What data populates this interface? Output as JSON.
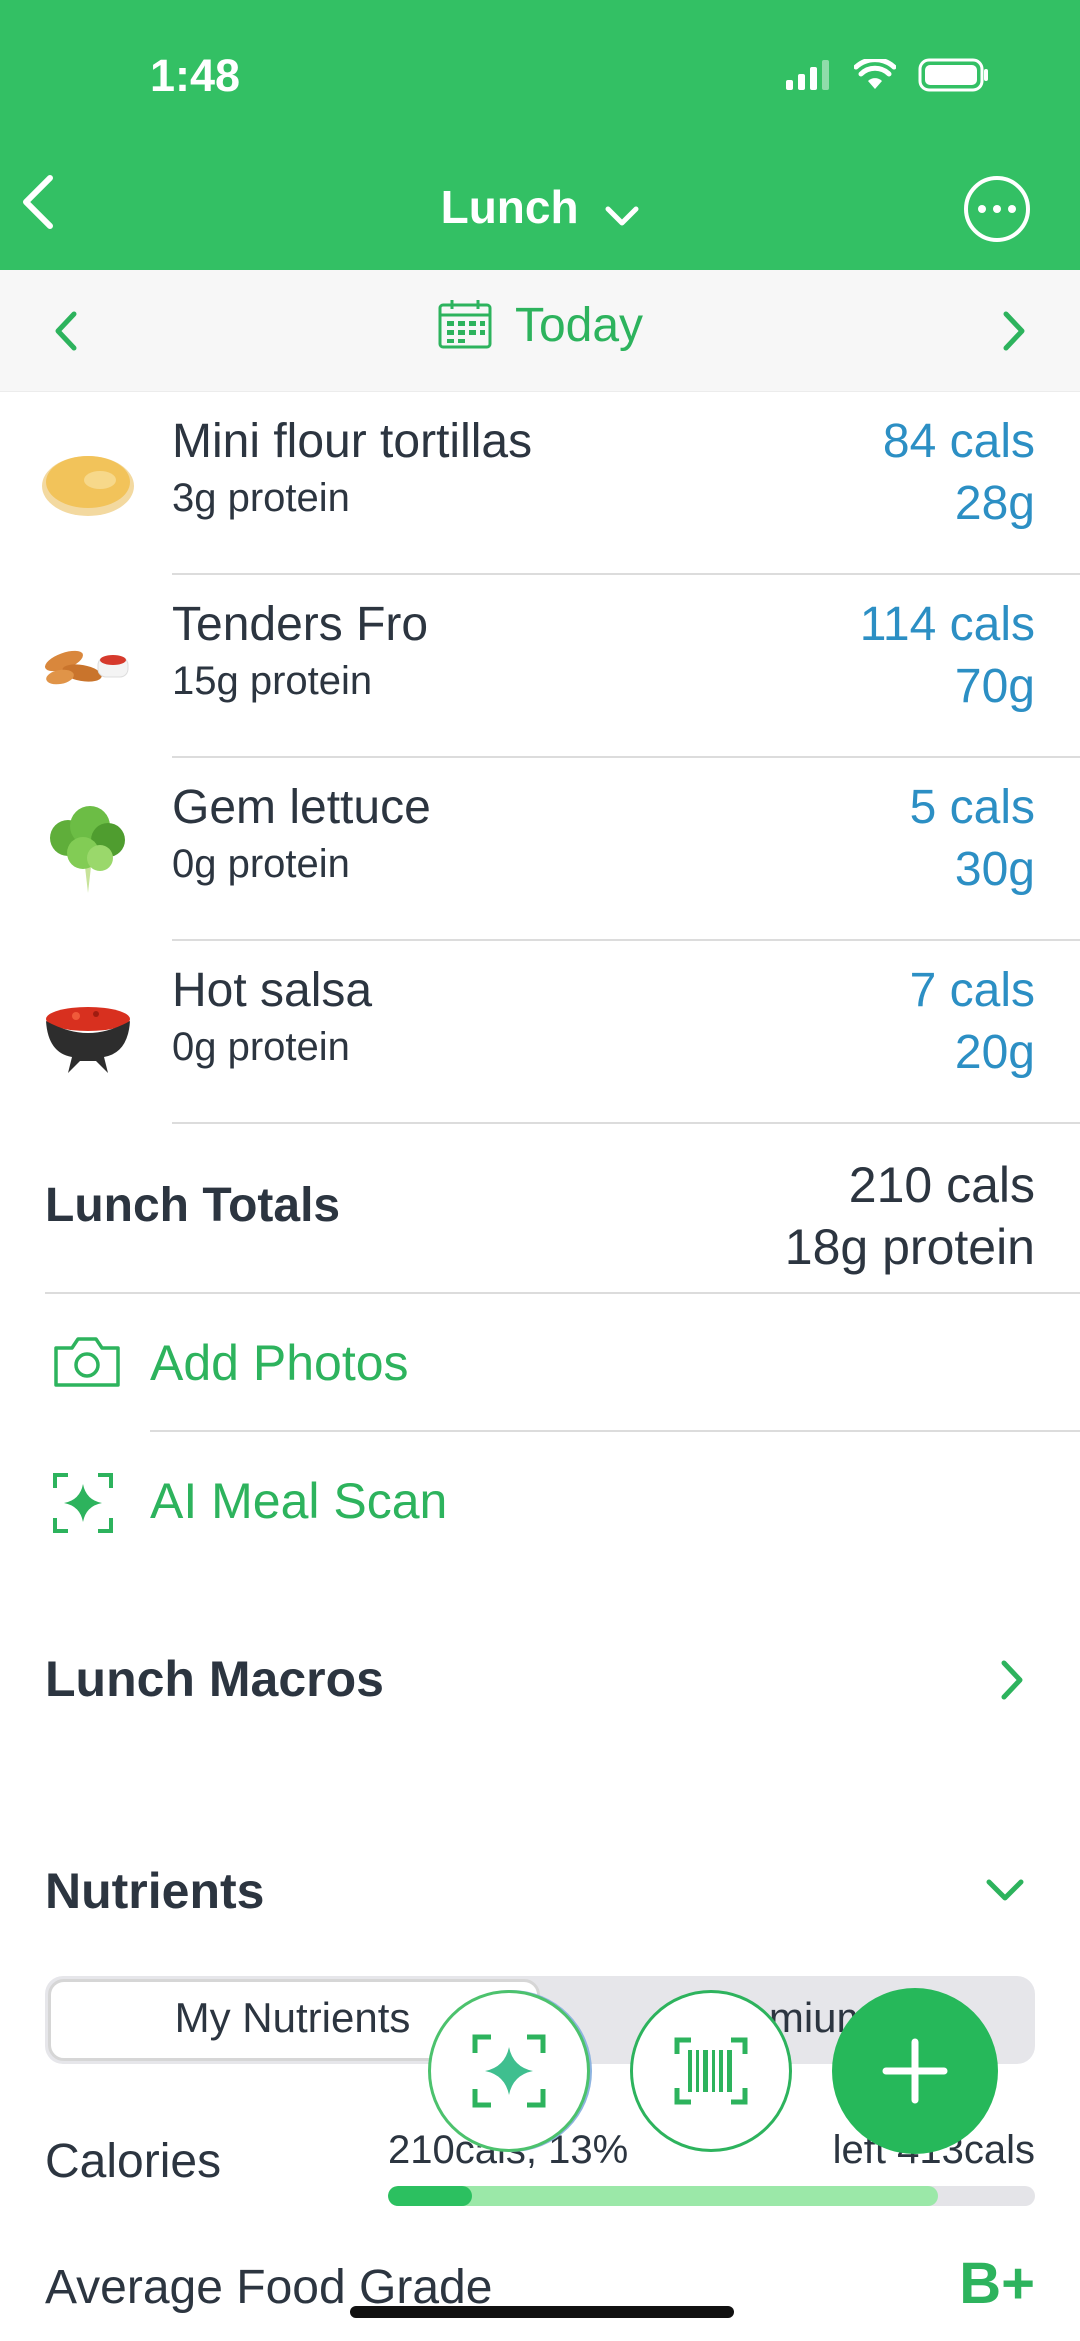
{
  "status_bar": {
    "time": "1:48"
  },
  "nav": {
    "title": "Lunch"
  },
  "date_bar": {
    "label": "Today"
  },
  "foods": [
    {
      "name": "Mini flour tortillas",
      "protein": "3g protein",
      "cals": "84 cals",
      "grams": "28g",
      "icon": "tortilla-icon"
    },
    {
      "name": "Tenders Fro",
      "protein": "15g protein",
      "cals": "114 cals",
      "grams": "70g",
      "icon": "chicken-tenders-icon"
    },
    {
      "name": "Gem lettuce",
      "protein": "0g protein",
      "cals": "5 cals",
      "grams": "30g",
      "icon": "lettuce-icon"
    },
    {
      "name": "Hot salsa",
      "protein": "0g protein",
      "cals": "7 cals",
      "grams": "20g",
      "icon": "salsa-bowl-icon"
    }
  ],
  "totals": {
    "label": "Lunch Totals",
    "cals": "210 cals",
    "protein": "18g protein"
  },
  "actions": {
    "add_photos": "Add Photos",
    "ai_meal_scan": "AI Meal Scan"
  },
  "sections": {
    "macros": "Lunch Macros",
    "nutrients": "Nutrients"
  },
  "segmented": {
    "tab1": "My Nutrients",
    "tab2": "Premium"
  },
  "calories": {
    "label": "Calories",
    "used": "210cals, 13%",
    "left": "left 413cals",
    "used_fraction": 0.13,
    "total_fraction": 0.85
  },
  "grade": {
    "label": "Average Food Grade",
    "value": "B+"
  },
  "colors": {
    "brand_green": "#33c064",
    "accent_blue": "#2c8fc4"
  }
}
